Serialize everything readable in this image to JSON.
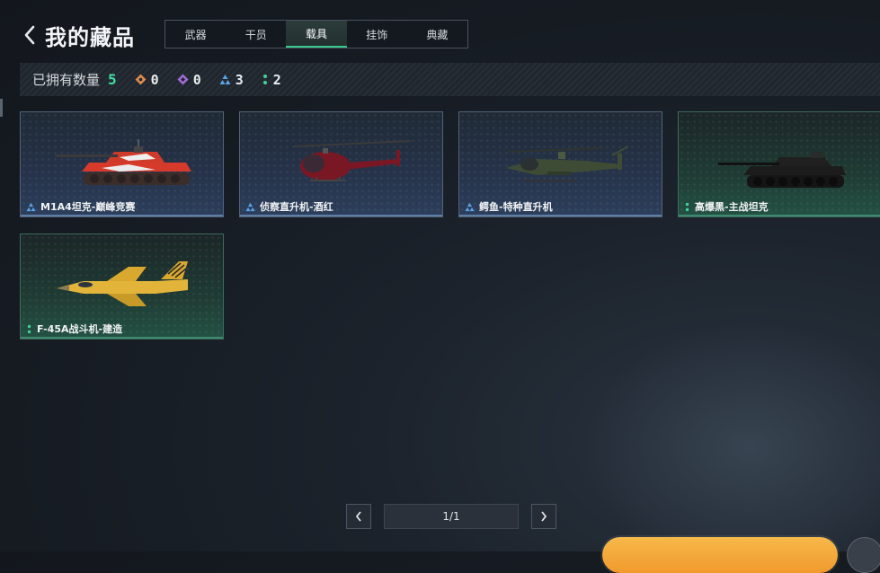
{
  "header": {
    "title": "我的藏品",
    "tabs": [
      {
        "label": "武器",
        "active": false
      },
      {
        "label": "干员",
        "active": false
      },
      {
        "label": "载具",
        "active": true
      },
      {
        "label": "挂饰",
        "active": false
      },
      {
        "label": "典藏",
        "active": false
      }
    ]
  },
  "owned": {
    "label": "已拥有数量",
    "total": "5",
    "rarities": [
      {
        "icon": "orange-diamond-icon",
        "color": "#d98a4e",
        "count": "0"
      },
      {
        "icon": "purple-diamond-icon",
        "color": "#a46bd8",
        "count": "0"
      },
      {
        "icon": "blue-triangle-icon",
        "color": "#5aa3e8",
        "count": "3"
      },
      {
        "icon": "green-dots-icon",
        "color": "#3fd39a",
        "count": "2"
      }
    ]
  },
  "items": [
    {
      "name": "M1A4坦克-巅峰竞赛",
      "rarity": "blue",
      "type": "tank"
    },
    {
      "name": "侦察直升机-酒红",
      "rarity": "blue",
      "type": "scout-heli"
    },
    {
      "name": "鳄鱼-特种直升机",
      "rarity": "blue",
      "type": "attack-heli"
    },
    {
      "name": "高爆黑-主战坦克",
      "rarity": "green",
      "type": "dark-tank"
    },
    {
      "name": "F-45A战斗机-建造",
      "rarity": "green",
      "type": "jet"
    }
  ],
  "pagination": {
    "text": "1/1"
  },
  "colors": {
    "accent": "#38c98e",
    "blue_rarity": "#5aa3e8",
    "green_rarity": "#3fd39a",
    "orange_button": "#f19a2c"
  }
}
